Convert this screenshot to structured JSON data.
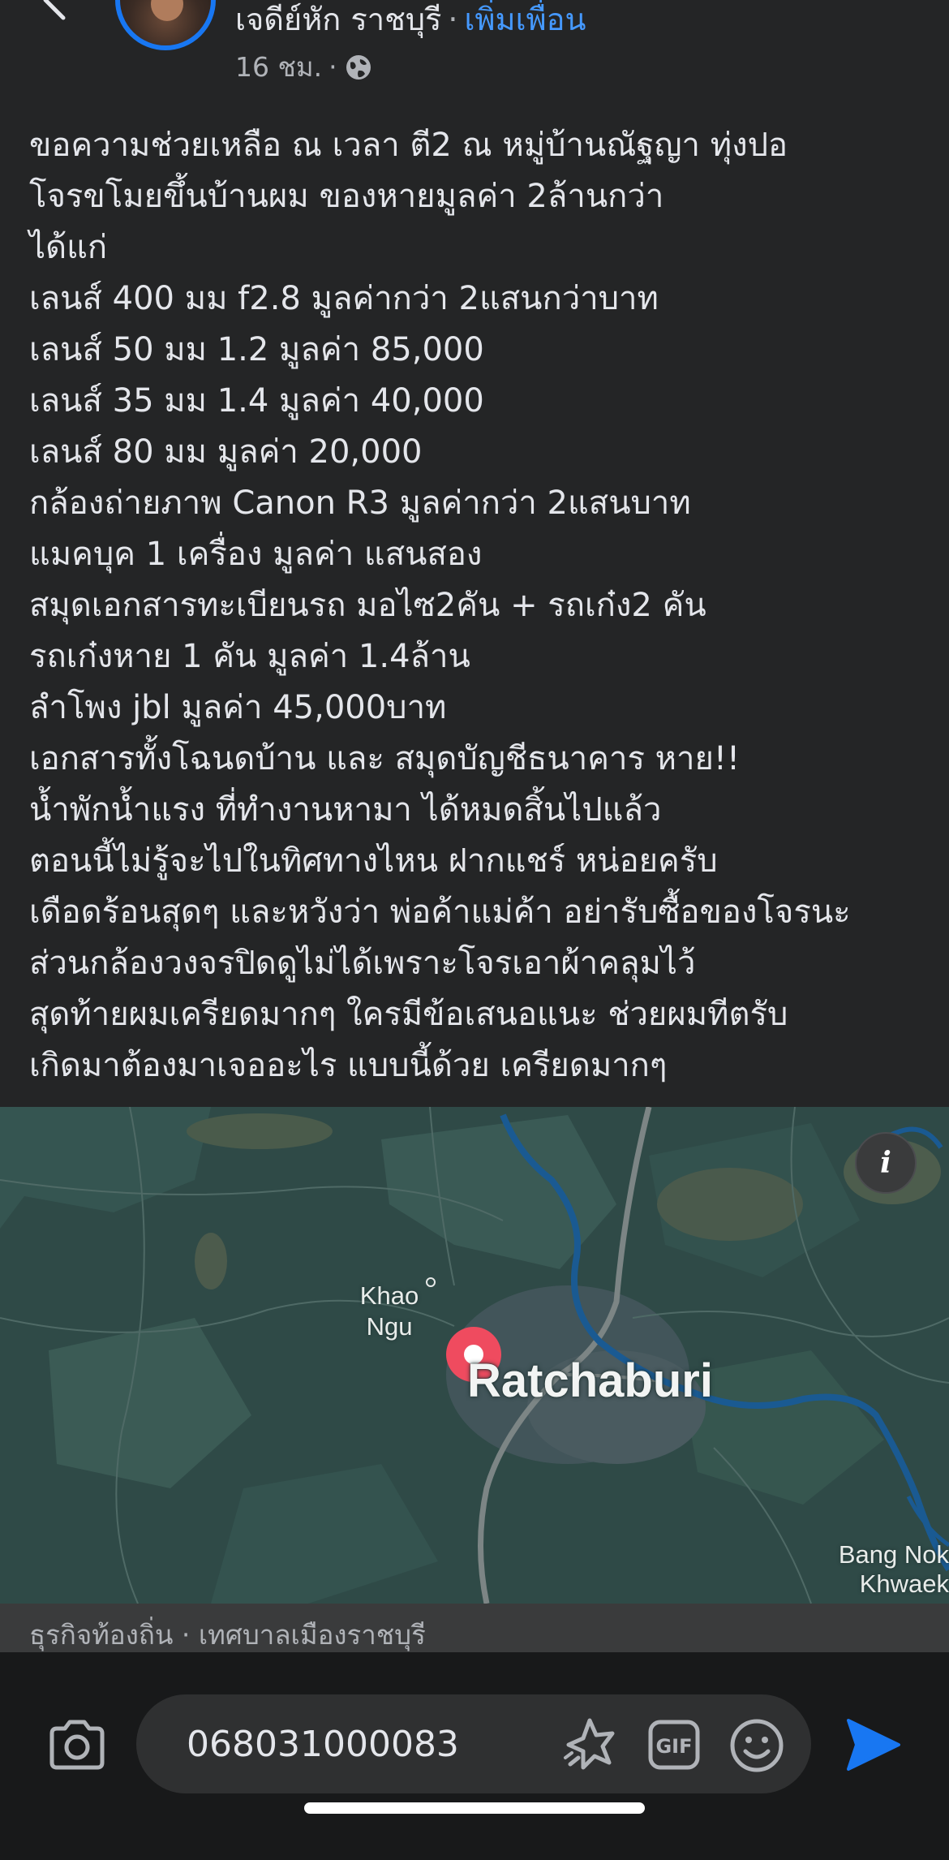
{
  "header": {
    "author_name": "เจดีย์หัก ราชบุรี",
    "separator": "·",
    "add_friend_label": "เพิ่มเพื่อน",
    "more_label": "···",
    "post_time": "16 ชม.",
    "time_separator": "·",
    "audience_icon": "globe-icon"
  },
  "post": {
    "lines": [
      "ขอความช่วยเหลือ ณ เวลา ตี2 ณ หมู่บ้านณัฐญา ทุ่งปอ",
      "โจรขโมยขึ้นบ้านผม ของหายมูลค่า 2ล้านกว่า",
      "ได้แก่",
      "เลนส์ 400 มม f2.8 มูลค่ากว่า 2แสนกว่าบาท",
      "เลนส์ 50 มม 1.2 มูลค่า 85,000",
      "เลนส์ 35 มม 1.4 มูลค่า 40,000",
      "เลนส์ 80 มม มูลค่า 20,000",
      "กล้องถ่ายภาพ Canon R3 มูลค่ากว่า 2แสนบาท",
      "แมคบุค 1 เครื่อง มูลค่า แสนสอง",
      "สมุดเอกสารทะเบียนรถ มอไซ2คัน + รถเก๋ง2 คัน",
      "รถเก๋งหาย 1 คัน มูลค่า 1.4ล้าน",
      "ลำโพง jbl มูลค่า 45,000บาท",
      "เอกสารทั้งโฉนดบ้าน และ สมุดบัญชีธนาคาร หาย!!",
      "น้ำพักน้ำแรง ที่ทำงานหามา ได้หมดสิ้นไปแล้ว",
      "ตอนนี้ไม่รู้จะไปในทิศทางไหน ฝากแชร์ หน่อยครับ",
      "เดือดร้อนสุดๆ และหวังว่า พ่อค้าแม่ค้า อย่ารับซื้อของโจรนะ",
      "ส่วนกล้องวงจรปิดดูไม่ได้เพราะโจรเอาผ้าคลุมไว้",
      "สุดท้ายผมเครียดมากๆ ใครมีข้อเสนอแนะ ช่วยผมทีตรับ",
      "เกิดมาต้องมาเจออะไร แบบนี้ด้วย เครียดมากๆ"
    ]
  },
  "map": {
    "info_label": "i",
    "labels": {
      "khao_ngu": "Khao\nNgu",
      "city": "Ratchaburi",
      "bang_nok_khwaek": "Bang Nok\nKhwaek"
    },
    "caption": "ธุรกิจท้องถิ่น · เทศบาลเมืองราชบุรี",
    "colors": {
      "land": "#2f4a47",
      "water": "#1a5a92",
      "road": "#7c8585",
      "pin": "#ef4b5f"
    }
  },
  "composer": {
    "comment_value": "068031000083",
    "camera_icon": "camera-icon",
    "sticker_icon": "sticker-icon",
    "gif_icon": "gif-icon",
    "emoji_icon": "emoji-icon",
    "send_icon": "send-icon",
    "accent_color": "#1877f2"
  }
}
